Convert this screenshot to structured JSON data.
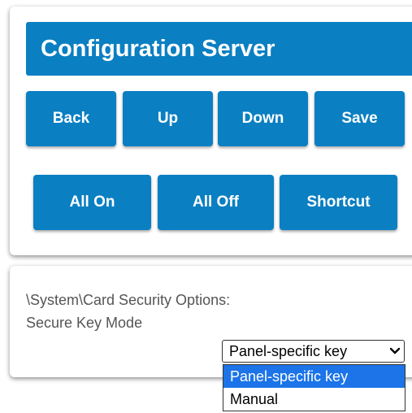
{
  "header": {
    "title": "Configuration Server"
  },
  "toolbar": {
    "back_label": "Back",
    "up_label": "Up",
    "down_label": "Down",
    "save_label": "Save",
    "all_on_label": "All On",
    "all_off_label": "All Off",
    "shortcut_label": "Shortcut"
  },
  "setting": {
    "path": "\\System\\Card Security Options:",
    "name": "Secure Key Mode",
    "selected_value": "Panel-specific key",
    "options": [
      {
        "label": "Panel-specific key",
        "highlighted": true
      },
      {
        "label": "Manual",
        "highlighted": false
      }
    ]
  },
  "colors": {
    "accent": "#0a7fc2",
    "option_highlight": "#1c74e8"
  }
}
